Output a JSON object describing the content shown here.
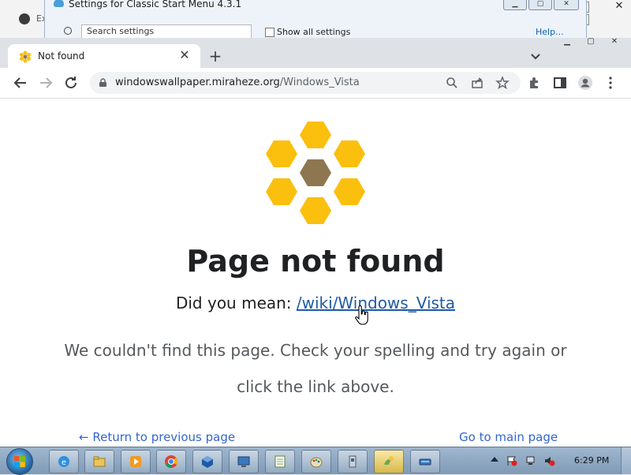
{
  "background_windows": {
    "left_window_label": "Ex",
    "settings_window": {
      "title": "Settings for Classic Start Menu 4.3.1",
      "search_placeholder": "Search settings",
      "show_all_label": "Show all settings",
      "help_label": "Help..."
    }
  },
  "browser": {
    "tab": {
      "title": "Not found",
      "favicon": "honeycomb-favicon-icon"
    },
    "new_tab_label": "+",
    "address": {
      "host": "windowswallpaper.miraheze.org",
      "path": "/Windows_Vista"
    }
  },
  "page": {
    "heading": "Page not found",
    "did_you_mean_prefix": "Did you mean: ",
    "did_you_mean_link": "/wiki/Windows_Vista",
    "message": "We couldn't find this page. Check your spelling and try again or click the link above.",
    "return_link": "← Return to previous page",
    "main_page_link": "Go to main page",
    "colors": {
      "hex_yellow": "#fbbf0d",
      "hex_center": "#8e7750",
      "link": "#3366cc"
    }
  },
  "taskbar": {
    "apps": [
      "ie-icon",
      "explorer-icon",
      "media-player-icon",
      "chrome-icon",
      "virtualbox-icon",
      "remote-desktop-icon",
      "notepad-icon",
      "paint-icon",
      "device-icon",
      "classic-shell-icon",
      "keyboard-icon"
    ],
    "clock": "6:29 PM"
  }
}
